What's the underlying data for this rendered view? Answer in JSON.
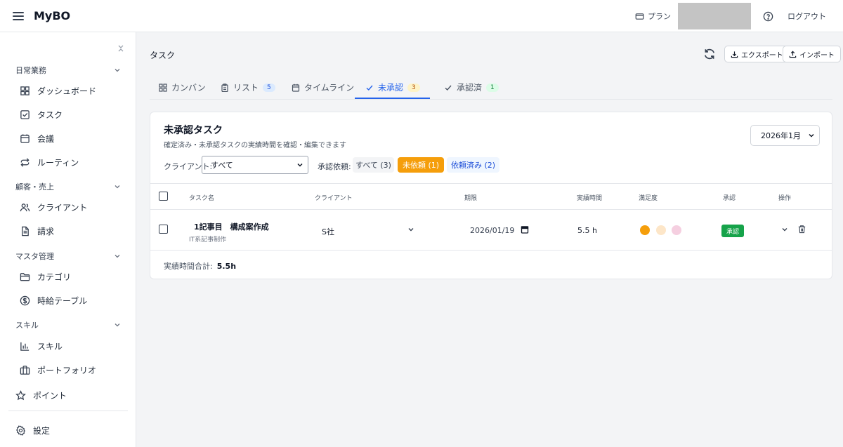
{
  "app": {
    "title": "MyBO"
  },
  "header": {
    "plan_label": "プラン",
    "logout_label": "ログアウト"
  },
  "sidebar": {
    "sections": [
      {
        "label": "日常業務",
        "items": [
          "ダッシュボード",
          "タスク",
          "会議",
          "ルーティン"
        ]
      },
      {
        "label": "顧客・売上",
        "items": [
          "クライアント",
          "請求"
        ]
      },
      {
        "label": "マスタ管理",
        "items": [
          "カテゴリ",
          "時給テーブル"
        ]
      },
      {
        "label": "スキル",
        "items": [
          "スキル",
          "ポートフォリオ"
        ]
      }
    ],
    "points_label": "ポイント",
    "settings_label": "設定"
  },
  "page": {
    "title": "タスク",
    "export_label": "エクスポート",
    "import_label": "インポート"
  },
  "tabs": [
    {
      "label": "カンバン",
      "icon": "kanban-icon"
    },
    {
      "label": "リスト",
      "icon": "clipboard-icon",
      "badge": "5"
    },
    {
      "label": "タイムライン",
      "icon": "calendar-icon"
    },
    {
      "label": "未承認",
      "icon": "check-icon",
      "badge": "3",
      "active": true
    },
    {
      "label": "承認済",
      "icon": "check-icon",
      "badge": "1"
    }
  ],
  "card": {
    "title": "未承認タスク",
    "subtitle": "確定済み・未承認タスクの実績時間を確認・編集できます",
    "month": "2026年1月",
    "client_filter_label": "クライアント:",
    "client_filter_value": "すべて",
    "request_filter_label": "承認依頼:",
    "pills": [
      "すべて (3)",
      "未依頼 (1)",
      "依頼済み (2)"
    ],
    "columns": [
      "タスク名",
      "クライアント",
      "期限",
      "実績時間",
      "満足度",
      "承認",
      "操作"
    ],
    "row": {
      "task_name": "1記事目　構成案作成",
      "category": "IT系記事制作",
      "client": "S社",
      "due_date": "2026/01/19",
      "hours": "5.5 h",
      "approve_label": "承認"
    },
    "total_label": "実績時間合計:",
    "total_value": "5.5h"
  },
  "colors": {
    "accent": "#2563eb",
    "pending_pill": "#f59e0b",
    "approve_green": "#16a34a"
  }
}
